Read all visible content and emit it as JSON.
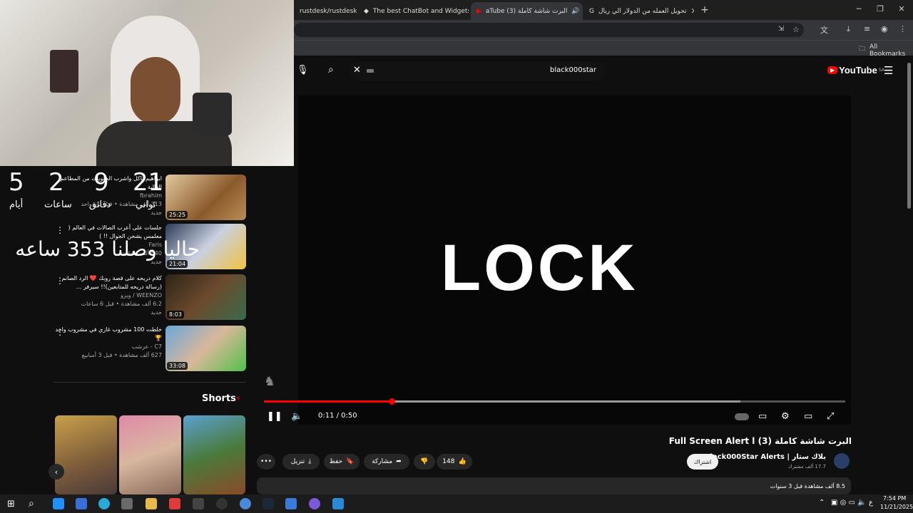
{
  "browser": {
    "tabs": [
      {
        "label": "rustdesk/rustdesk",
        "close": "✕"
      },
      {
        "label": "The best ChatBot and Widgets",
        "close": "✕"
      },
      {
        "label": "aTube (3) البرت شاشة كاملة",
        "close": "✕"
      },
      {
        "label": "تحويل العمله من الدولار الي ريال",
        "close": "✕"
      }
    ],
    "new_tab": "+",
    "bookmarks_label": "All Bookmarks"
  },
  "overlay": {
    "countdown": [
      {
        "value": "21",
        "label": "ثواني"
      },
      {
        "value": "9",
        "label": "دقائق"
      },
      {
        "value": "2",
        "label": "ساعات"
      },
      {
        "value": "5",
        "label": "أيام"
      }
    ],
    "banner": "حاليا وصلنا 353 ساعه"
  },
  "youtube": {
    "logo_text": "YouTube",
    "logo_region": "SA",
    "search_value": "black000star",
    "player": {
      "lock_text": "LOCK",
      "time": "0:11 / 0:50",
      "progress": 0.22,
      "buffered": 0.82
    },
    "title": "البرت شاشة كاملة (3) Full Screen Alert l",
    "channel": {
      "name": "بلاك ستار | Black000Star Alerts",
      "subs": "17.7 ألف مشترك",
      "subscribe": "اشتراك"
    },
    "actions": {
      "likes": "148",
      "share": "مشاركة",
      "save": "حفظ",
      "download": "تنزيل",
      "more": "•••"
    },
    "description": "8.5 ألف مشاهدة  قبل 3 سنوات",
    "shorts_label": "Shorts",
    "sidebar": [
      {
        "title": "ابراهيم ياكل واشرب الحلويات من المطاعم الغالية",
        "channel": "fbrahim",
        "stats": "313 ألف مشاهدة • قبل يوم واحد",
        "duration": "25:25",
        "badge": "جديد"
      },
      {
        "title": "جلسات على أعرب الصالات في العالم ( معلمس يشحن الجوال !! )",
        "channel": "Faris",
        "stats": "540 ألف مشاهدة",
        "duration": "21:04",
        "badge": "جديد"
      },
      {
        "title": "كلام دريحه على قصة روبك ❤️ الرد الصانم (رسالة دريحه للمتابعين)!! سيرفر ...",
        "channel": "WEENZO / ويزو",
        "stats": "6.2 ألف مشاهدة • قبل 6 ساعات",
        "duration": "8:03",
        "badge": "جديد"
      },
      {
        "title": "خلطت 100 مشروب غازي في مشروب واحد 🏆",
        "channel": "C7 - عرشب",
        "stats": "627 ألف مشاهدة • قبل 3 أسابيع",
        "duration": "33:08",
        "badge": ""
      }
    ]
  },
  "taskbar": {
    "time": "7:54 PM",
    "date": "11/21/2025",
    "lang": "ع"
  },
  "colors": {
    "accent": "#ff0000",
    "bg": "#0f0f0f"
  }
}
